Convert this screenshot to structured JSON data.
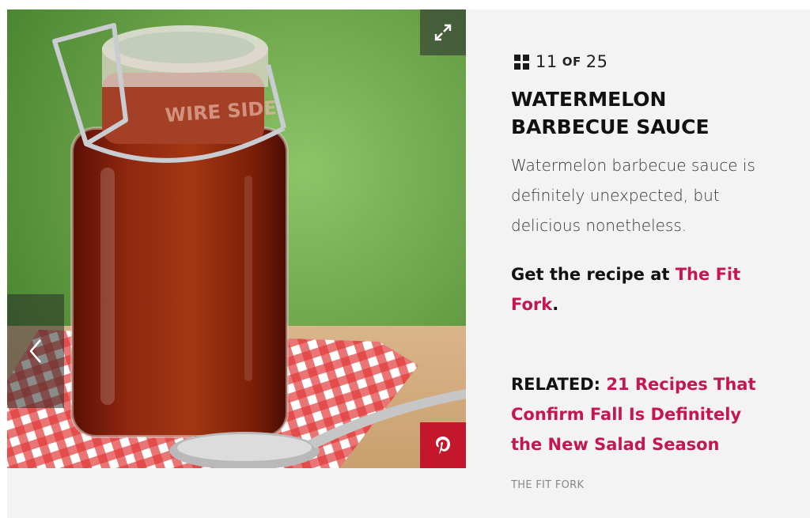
{
  "slideshow": {
    "current": "11",
    "of_label": "OF",
    "total": "25"
  },
  "slide": {
    "title": "WATERMELON BARBECUE SAUCE",
    "description": "Watermelon barbecue sauce is definitely unexpected, but delicious nonetheless.",
    "recipe_prefix": "Get the recipe at ",
    "recipe_link": "The Fit Fork",
    "recipe_suffix": ".",
    "related_label": "RELATED:",
    "related_link": "21 Recipes That Confirm Fall Is Definitely the New Salad Season",
    "credit": "THE FIT FORK",
    "jar_embossing": "WIRE SIDE"
  },
  "icons": {
    "grid": "grid-icon",
    "expand": "expand-icon",
    "previous": "chevron-left-icon",
    "pinterest": "pinterest-icon"
  },
  "colors": {
    "link": "#c4174f",
    "pinterest": "#c4172c",
    "background": "#f4f3f3"
  }
}
